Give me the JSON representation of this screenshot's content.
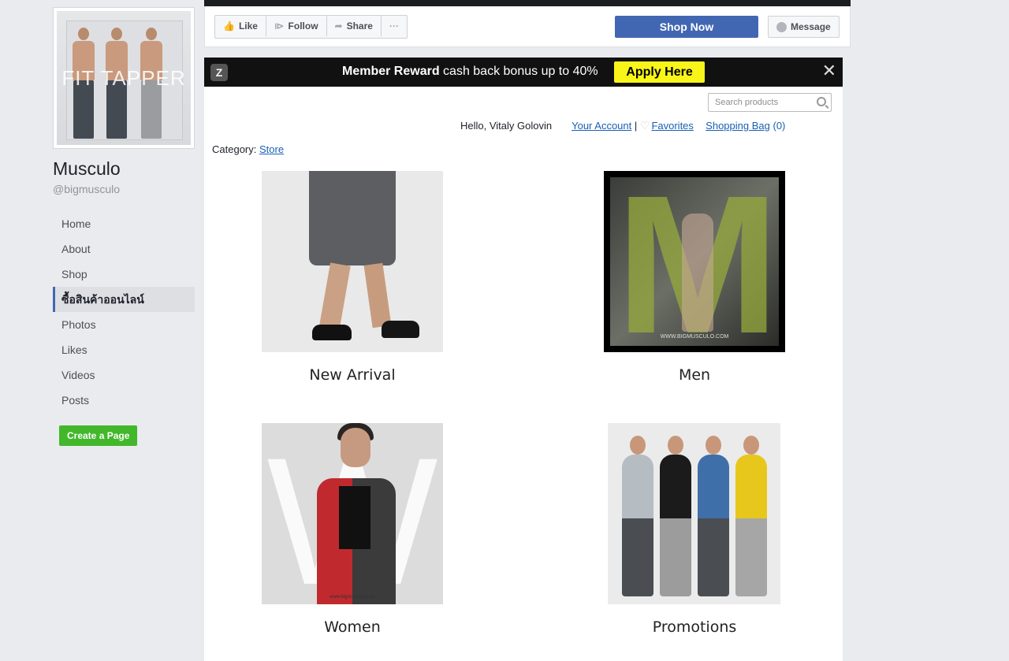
{
  "sidebar": {
    "profile_watermark": "FIT TAPPER",
    "page_name": "Musculo",
    "page_handle": "@bigmusculo",
    "nav": [
      "Home",
      "About",
      "Shop",
      "ซื้อสินค้าออนไลน์",
      "Photos",
      "Likes",
      "Videos",
      "Posts"
    ],
    "active_index": 3,
    "create_page": "Create a Page"
  },
  "actions": {
    "like": "Like",
    "follow": "Follow",
    "share": "Share",
    "more": "···",
    "shop_now": "Shop Now",
    "message": "Message"
  },
  "banner": {
    "bold": "Member Reward",
    "text": " cash back bonus up to 40%",
    "apply": "Apply Here",
    "close": "✕"
  },
  "store": {
    "search_placeholder": "Search products",
    "greeting": "Hello, Vitaly Golovin",
    "your_account": "Your Account",
    "separator": "|",
    "favorites": "Favorites",
    "shopping_bag": "Shopping Bag",
    "bag_count": "(0)",
    "category_label": "Category:",
    "category_value": "Store",
    "tiles": [
      {
        "label": "New Arrival"
      },
      {
        "label": "Men",
        "site": "WWW.BIGMUSCULO.COM"
      },
      {
        "label": "Women",
        "site": "www.bigmusculo.com"
      },
      {
        "label": "Promotions"
      }
    ]
  }
}
